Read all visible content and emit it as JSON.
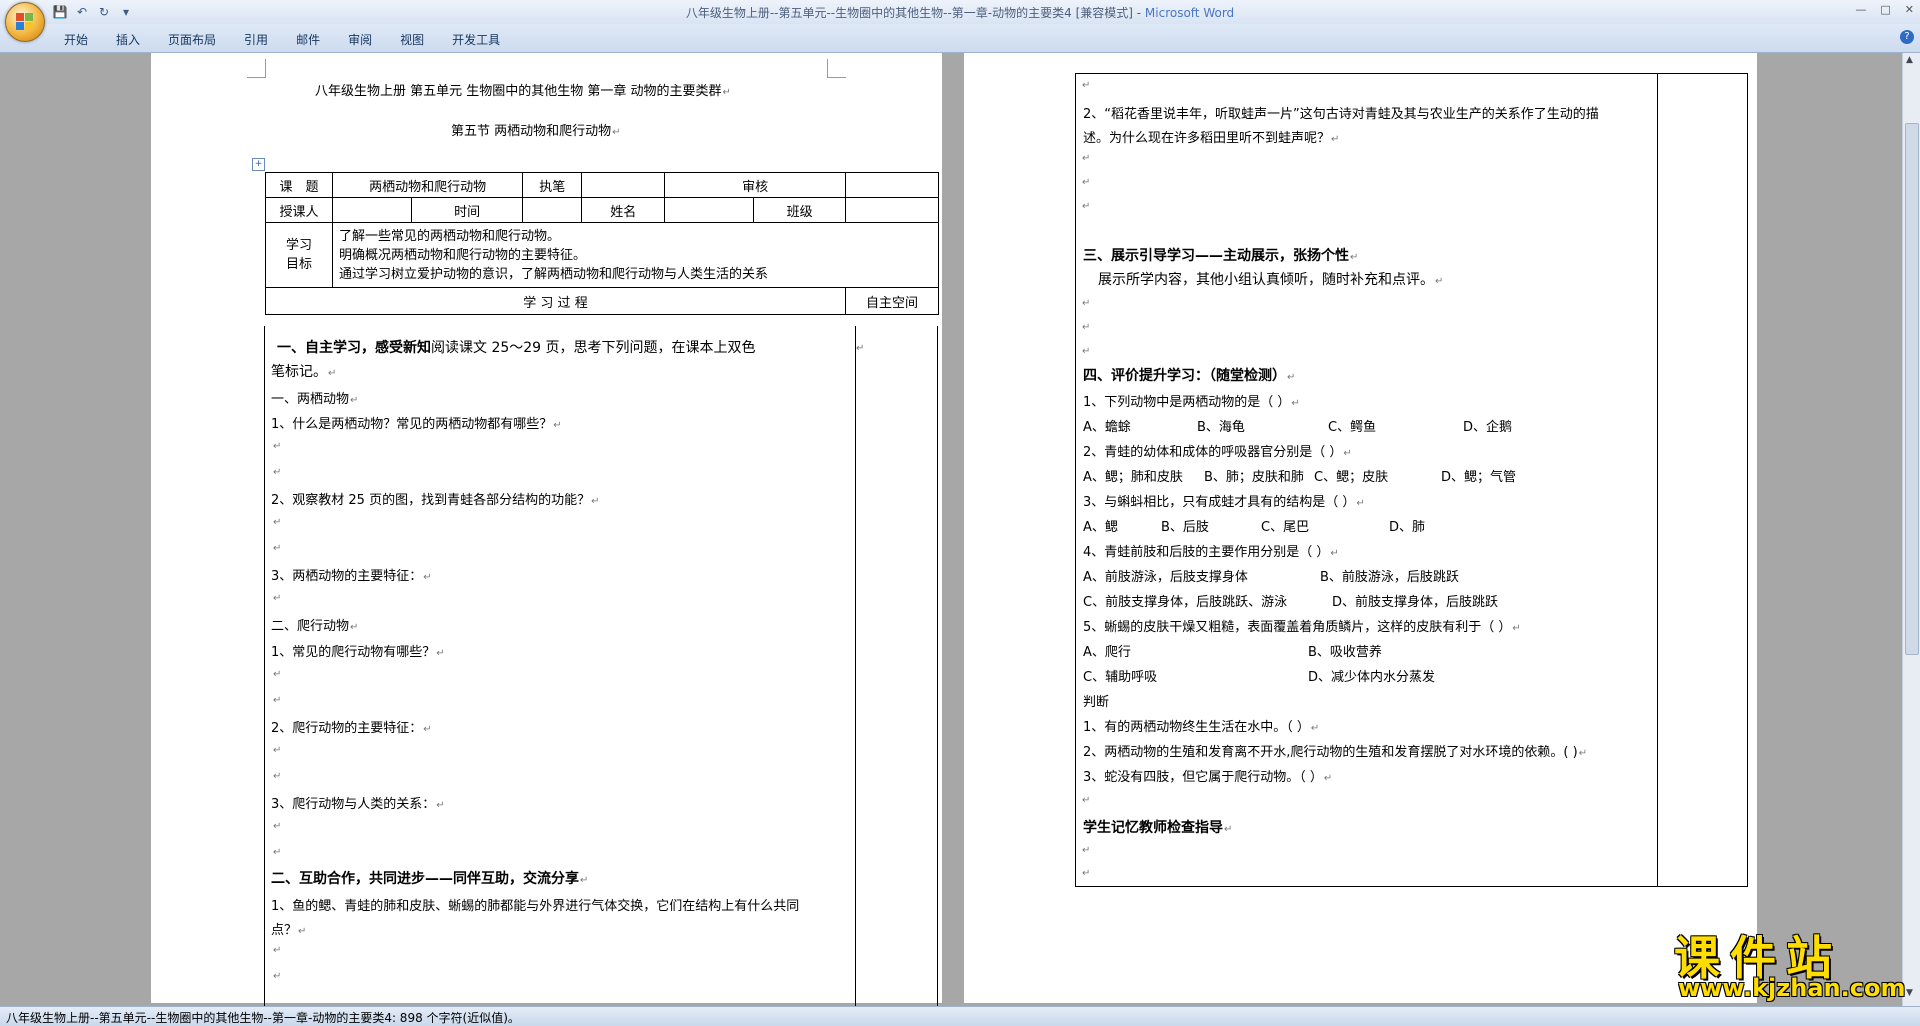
{
  "window": {
    "title": "八年级生物上册--第五单元--生物圈中的其他生物--第一章-动物的主要类4 [兼容模式] - ",
    "app_name": "Microsoft Word"
  },
  "ribbon_tabs": [
    "开始",
    "插入",
    "页面布局",
    "引用",
    "邮件",
    "审阅",
    "视图",
    "开发工具"
  ],
  "page1": {
    "header": "八年级生物上册   第五单元   生物圈中的其他生物   第一章  动物的主要类群",
    "section": "第五节      两栖动物和爬行动物",
    "info_row1": {
      "topic_label": "课　题",
      "topic_value": "两栖动物和爬行动物",
      "writer_label": "执笔",
      "reviewer_label": "审核"
    },
    "info_row2": {
      "teacher_label": "授课人",
      "time_label": "时间",
      "name_label": "姓名",
      "class_label": "班级"
    },
    "objectives_label_1": "学习",
    "objectives_label_2": "目标",
    "objectives": [
      "了解一些常见的两栖动物和爬行动物。",
      "明确概况两栖动物和爬行动物的主要特征。",
      "通过学习树立爱护动物的意识，了解两栖动物和爬行动物与人类生活的关系"
    ],
    "process_header": "学 习 过 程",
    "space_header": "自主空间",
    "s1_title": "一、自主学习，感受新知",
    "s1_text_a": "阅读课文 25～29 页，思考下列问题，在课本上双色",
    "s1_text_b": "笔标记。",
    "amphibian_title": "一、两栖动物",
    "q_a1": "1、什么是两栖动物？常见的两栖动物都有哪些？",
    "q_a2": "2、观察教材 25 页的图，找到青蛙各部分结构的功能？",
    "q_a3": "3、两栖动物的主要特征：",
    "reptile_title": "二、爬行动物",
    "q_r1": "1、常见的爬行动物有哪些？",
    "q_r2": "2、爬行动物的主要特征：",
    "q_r3": "3、爬行动物与人类的关系：",
    "s2_title": "二、互助合作，共同进步——同伴互助，交流分享",
    "s2_q1a": "1、鱼的鳃、青蛙的肺和皮肤、蜥蜴的肺都能与外界进行气体交换，它们在结构上有什么共同",
    "s2_q1b": "点？"
  },
  "page2": {
    "q2a": "2、“稻花香里说丰年，听取蛙声一片”这句古诗对青蛙及其与农业生产的关系作了生动的描",
    "q2b": "述。为什么现在许多稻田里听不到蛙声呢？",
    "s3_title": "三、展示引导学习——主动展示，张扬个性",
    "s3_text": "展示所学内容，其他小组认真倾听，随时补充和点评。",
    "s4_title": "四、评价提升学习：（随堂检测）",
    "t1": "1、下列动物中是两栖动物的是（          ）",
    "t1_opts": [
      "A、蟾蜍",
      "B、海龟",
      "C、鳄鱼",
      "D、企鹅"
    ],
    "t2": "2、青蛙的幼体和成体的呼吸器官分别是（          ）",
    "t2_opts": [
      "A、鳃；肺和皮肤",
      "B、肺；皮肤和肺",
      "C、鳃；皮肤",
      "D、鳃；气管"
    ],
    "t3": "3、与蝌蚪相比，只有成蛙才具有的结构是（          ）",
    "t3_opts": [
      "A、鳃",
      "B、后肢",
      "C、尾巴",
      "D、肺"
    ],
    "t4": "4、青蛙前肢和后肢的主要作用分别是（          ）",
    "t4_a": "A、前肢游泳，后肢支撑身体",
    "t4_b": "B、前肢游泳，后肢跳跃",
    "t4_c": "C、前肢支撑身体，后肢跳跃、游泳",
    "t4_d": "D、前肢支撑身体，后肢跳跃",
    "t5": "5、蜥蜴的皮肤干燥又粗糙，表面覆盖着角质鳞片，这样的皮肤有利于（          ）",
    "t5_a": "A、爬行",
    "t5_b": "B、吸收营养",
    "t5_c": "C、辅助呼吸",
    "t5_d": "D、减少体内水分蒸发",
    "judge_title": "判断",
    "j1": "1、有的两栖动物终生生活在水中。（          ）",
    "j2": "2、两栖动物的生殖和发育离不开水,爬行动物的生殖和发育摆脱了对水环境的依赖。(          )",
    "j3": "3、蛇没有四肢，但它属于爬行动物。（          ）",
    "memory_title": "学生记忆教师检查指导"
  },
  "status_bar": "八年级生物上册--第五单元--生物圈中的其他生物--第一章-动物的主要类4: 898 个字符(近似值)。",
  "watermark": {
    "text": "课件站",
    "url": "www.kjzhan.com"
  }
}
